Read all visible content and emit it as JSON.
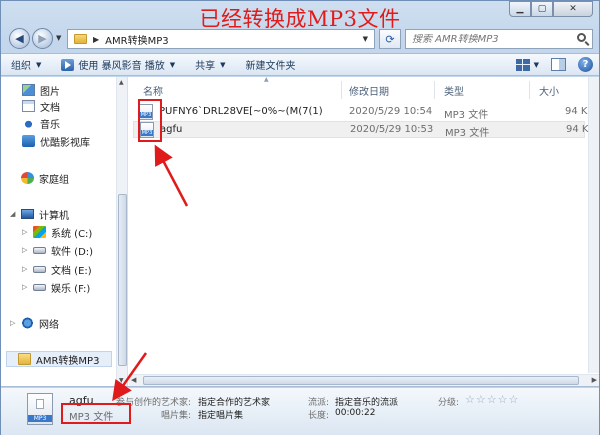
{
  "overlay": {
    "title": "已经转换成MP3文件"
  },
  "address": {
    "path": "AMR转换MP3"
  },
  "search": {
    "placeholder": "搜索 AMR转换MP3"
  },
  "toolbar": {
    "organize": "组织",
    "play_with": "使用 暴风影音 播放",
    "share": "共享",
    "new_folder": "新建文件夹"
  },
  "nav": {
    "favorites": [
      {
        "label": "图片",
        "icon": "pictures-icon"
      },
      {
        "label": "文档",
        "icon": "documents-icon"
      },
      {
        "label": "音乐",
        "icon": "music-icon"
      },
      {
        "label": "优酷影视库",
        "icon": "video-library-icon"
      }
    ],
    "homegroup": "家庭组",
    "computer": "计算机",
    "drives": [
      {
        "label": "系统 (C:)"
      },
      {
        "label": "软件 (D:)"
      },
      {
        "label": "文档 (E:)"
      },
      {
        "label": "娱乐 (F:)"
      }
    ],
    "network": "网络",
    "folder": "AMR转换MP3"
  },
  "columns": {
    "name": "名称",
    "date": "修改日期",
    "type": "类型",
    "size": "大小"
  },
  "files": [
    {
      "name": "PUFNY6`DRL28VE[~0%~(M(7(1)",
      "date": "2020/5/29 10:54",
      "type": "MP3 文件",
      "size": "94 KB"
    },
    {
      "name": "agfu",
      "date": "2020/5/29 10:53",
      "type": "MP3 文件",
      "size": "94 KB"
    }
  ],
  "details": {
    "icon_label": "MP3",
    "name": "agfu",
    "type": "MP3 文件",
    "contributing_artists_label": "参与创作的艺术家:",
    "contributing_artists_value": "指定合作的艺术家",
    "album_label": "唱片集:",
    "album_value": "指定唱片集",
    "genre_label": "流派:",
    "genre_value": "指定音乐的流派",
    "length_label": "长度:",
    "length_value": "00:00:22",
    "rating_label": "分级:",
    "rating_stars": "☆☆☆☆☆"
  },
  "colors": {
    "annotation": "#e01b1b",
    "selection": "#f0f0f0",
    "toolbar_text": "#1e395b"
  }
}
